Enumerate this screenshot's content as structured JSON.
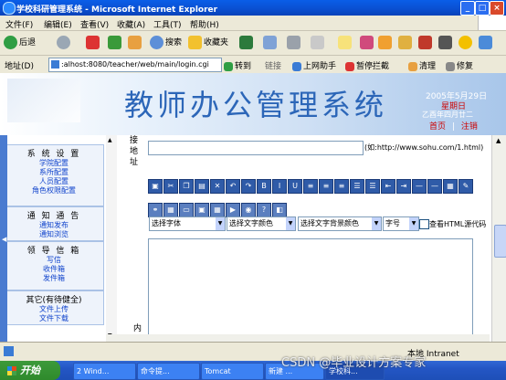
{
  "window": {
    "title": "学校科研管理系统 - Microsoft Internet Explorer",
    "controls": [
      "_",
      "□",
      "×"
    ]
  },
  "menu": [
    "文件(F)",
    "编辑(E)",
    "查看(V)",
    "收藏(A)",
    "工具(T)",
    "帮助(H)"
  ],
  "toolbar": {
    "back": "后退",
    "search": "搜索",
    "favorites": "收藏夹"
  },
  "address": {
    "label": "地址(D)",
    "url": ":alhost:8080/teacher/web/main/login.cgi",
    "go": "转到",
    "links": "链接",
    "extra": [
      "上网助手",
      "暂停拦截",
      "清理",
      "修复"
    ]
  },
  "banner": {
    "title": "教师办公管理系统",
    "date": "2005年5月29日",
    "weekday": "星期日",
    "lunar": "乙酉年四月廿二",
    "home": "首页",
    "separator": "|",
    "logout": "注销"
  },
  "sidebar": {
    "groups": [
      {
        "head": "系 统 设 置",
        "items": [
          "学院配置",
          "系所配置",
          "人员配置",
          "角色权限配置"
        ]
      },
      {
        "head": "通 知 通 告",
        "items": [
          "通知发布",
          "通知浏览"
        ]
      },
      {
        "head": "领 导 信 箱",
        "items": [
          "写信",
          "收件箱",
          "发件箱"
        ]
      },
      {
        "head": "其它(有待健全)",
        "items": [
          "文件上传",
          "文件下载"
        ]
      }
    ]
  },
  "form": {
    "url_label": "接地址",
    "url_hint": "(如:http://www.sohu.com/1.html)",
    "font_select": "选择字体",
    "color_select": "选择文字颜色",
    "bg_select": "选择文字背景颜色",
    "size_select": "字号",
    "html_check": "查看HTML源代码",
    "content_label": "内"
  },
  "statusbar": {
    "zone": "本地 Intranet"
  },
  "taskbar": {
    "start": "开始",
    "tasks": [
      "2 Wind...",
      "命令提...",
      "Tomcat",
      "新建 ...",
      "学校科..."
    ]
  },
  "watermark": "CSDN @毕业设计方案专家"
}
